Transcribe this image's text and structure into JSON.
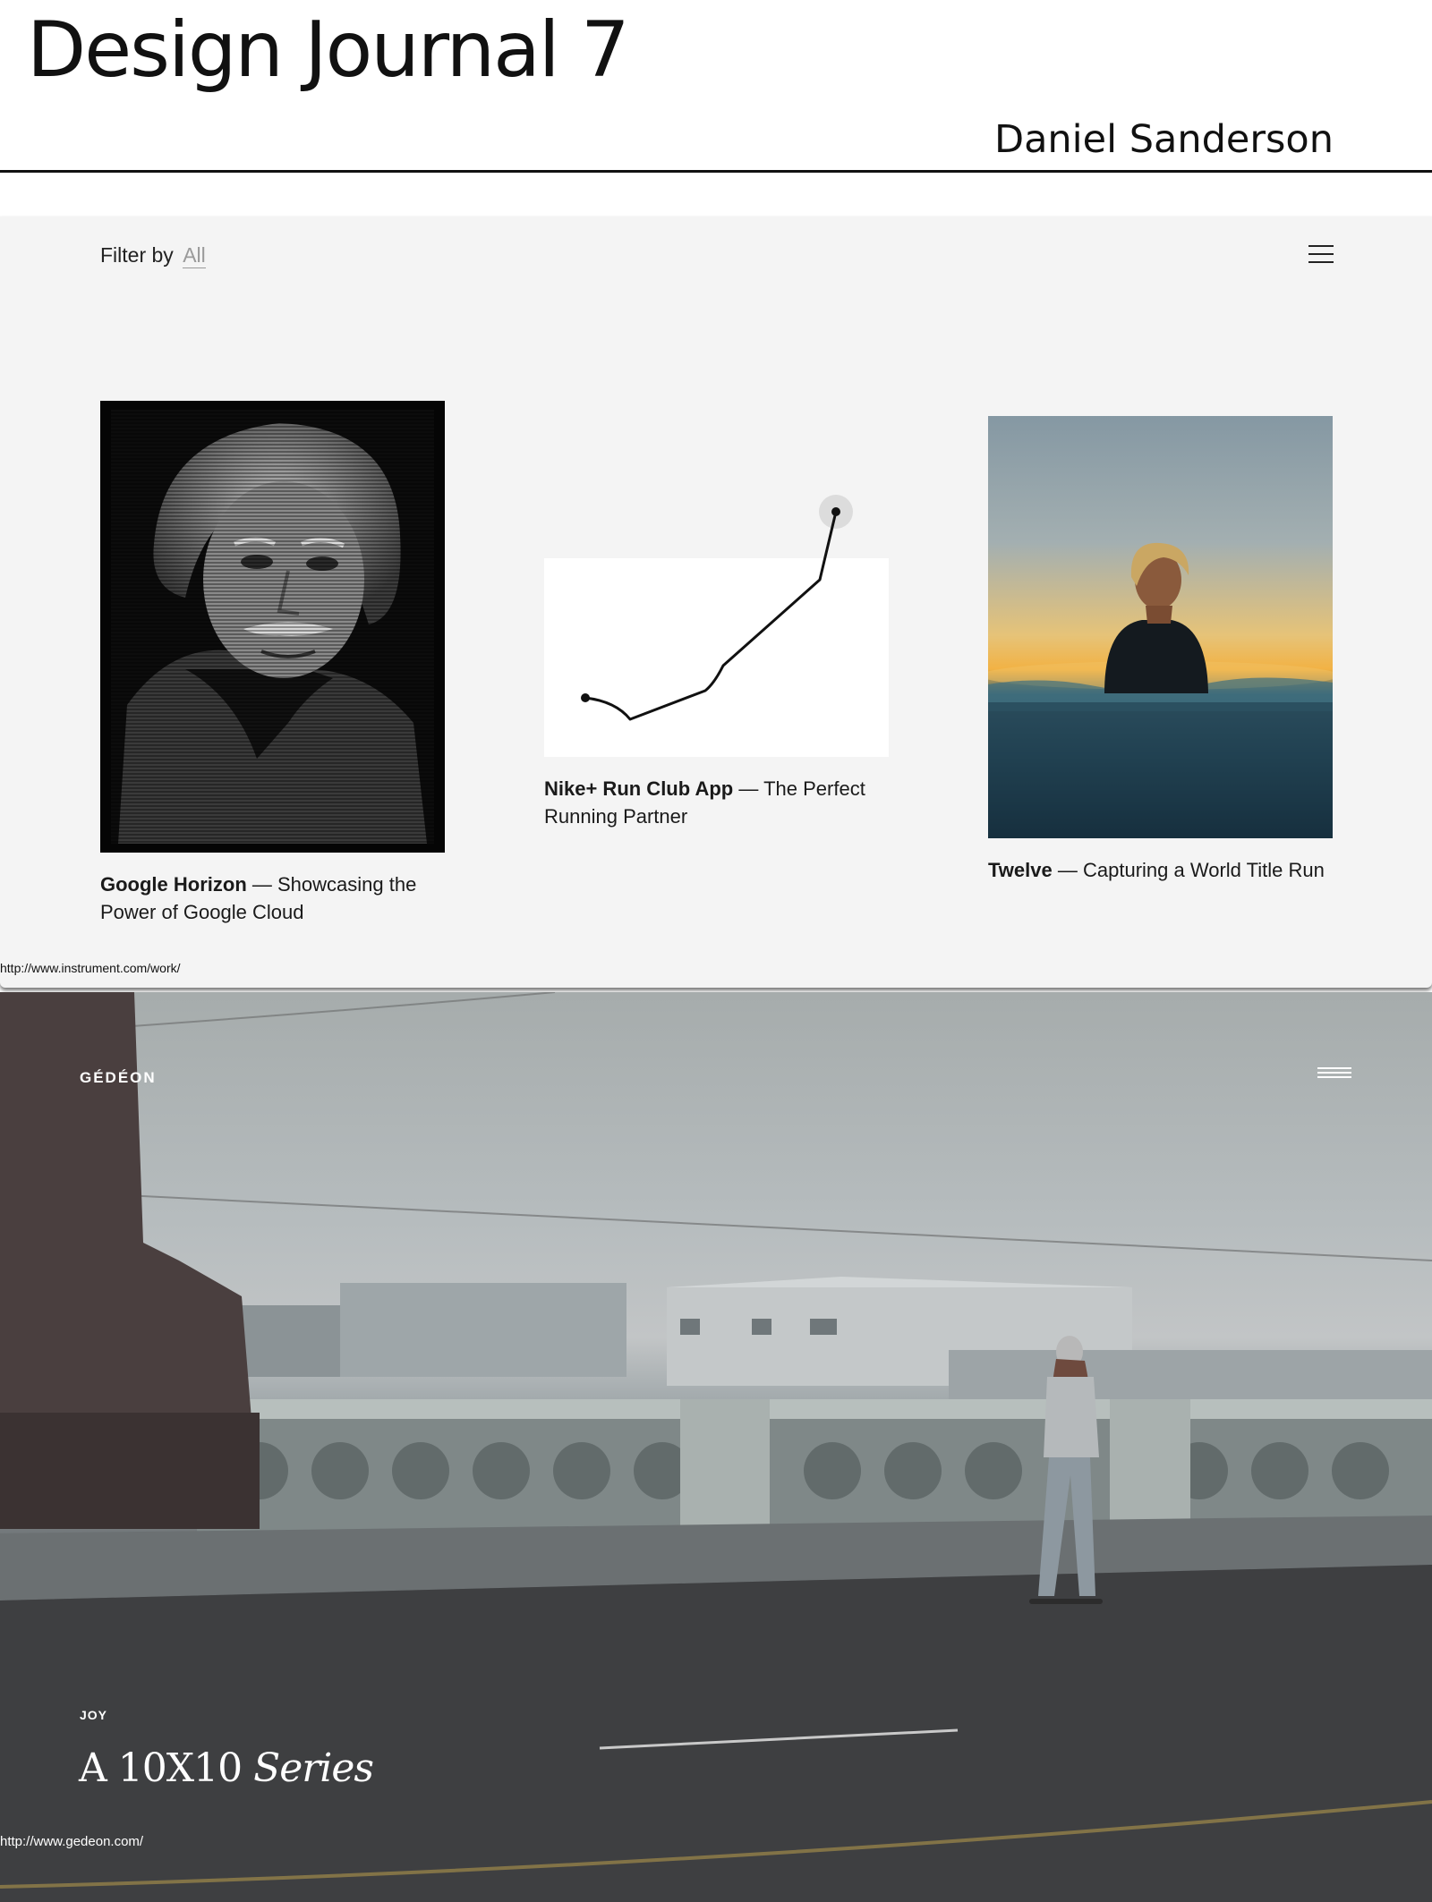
{
  "journal": {
    "title": "Design Journal 7",
    "author": "Daniel Sanderson"
  },
  "instrument": {
    "filter_label": "Filter by",
    "filter_value": "All",
    "menu_icon": "hamburger-icon",
    "projects": [
      {
        "title": "Google Horizon",
        "description": "— Showcasing the Power of Google Cloud"
      },
      {
        "title": "Nike+ Run Club App",
        "description": "— The Perfect Running Partner"
      },
      {
        "title": "Twelve",
        "description": "— Capturing a World Title Run"
      }
    ],
    "url": "http://www.instrument.com/work/"
  },
  "gedeon": {
    "logo": "GÉDÉON",
    "menu_icon": "hamburger-icon",
    "kicker": "JOY",
    "headline_main": "A 10X10",
    "headline_italic": "Series",
    "url": "http://www.gedeon.com/"
  }
}
